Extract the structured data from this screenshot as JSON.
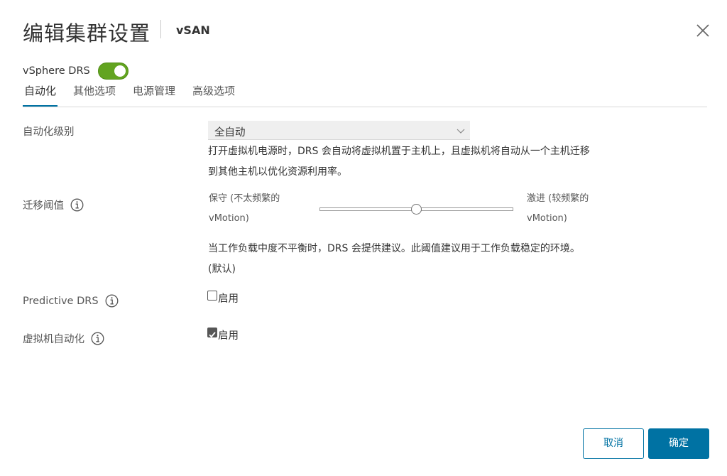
{
  "dialog": {
    "title": "编辑集群设置",
    "cluster_name": "vSAN"
  },
  "drs": {
    "label": "vSphere DRS",
    "enabled": true,
    "accent_color": "#62a420"
  },
  "tabs": [
    {
      "label": "自动化",
      "active": true
    },
    {
      "label": "其他选项",
      "active": false
    },
    {
      "label": "电源管理",
      "active": false
    },
    {
      "label": "高级选项",
      "active": false
    }
  ],
  "automation_level": {
    "label": "自动化级别",
    "value": "全自动",
    "desc_line1": "打开虚拟机电源时，DRS 会自动将虚拟机置于主机上，且虚拟机将自动从一个主机迁移",
    "desc_line2": "到其他主机以优化资源利用率。"
  },
  "migration_threshold": {
    "label": "迁移阈值",
    "left_line1": "保守 (不太频繁的",
    "left_line2": "vMotion)",
    "right_line1": "激进 (较频繁的",
    "right_line2": "vMotion)",
    "level": 3,
    "level_max": 5,
    "desc_line1": "当工作负载中度不平衡时，DRS 会提供建议。此阈值建议用于工作负载稳定的环境。",
    "desc_line2": "(默认)"
  },
  "predictive_drs": {
    "label": "Predictive DRS",
    "checkbox_label": "启用",
    "checked": false
  },
  "vm_automation": {
    "label": "虚拟机自动化",
    "checkbox_label": "启用",
    "checked": true
  },
  "footer": {
    "cancel_label": "取消",
    "ok_label": "确定",
    "primary_color": "#0072a3"
  }
}
